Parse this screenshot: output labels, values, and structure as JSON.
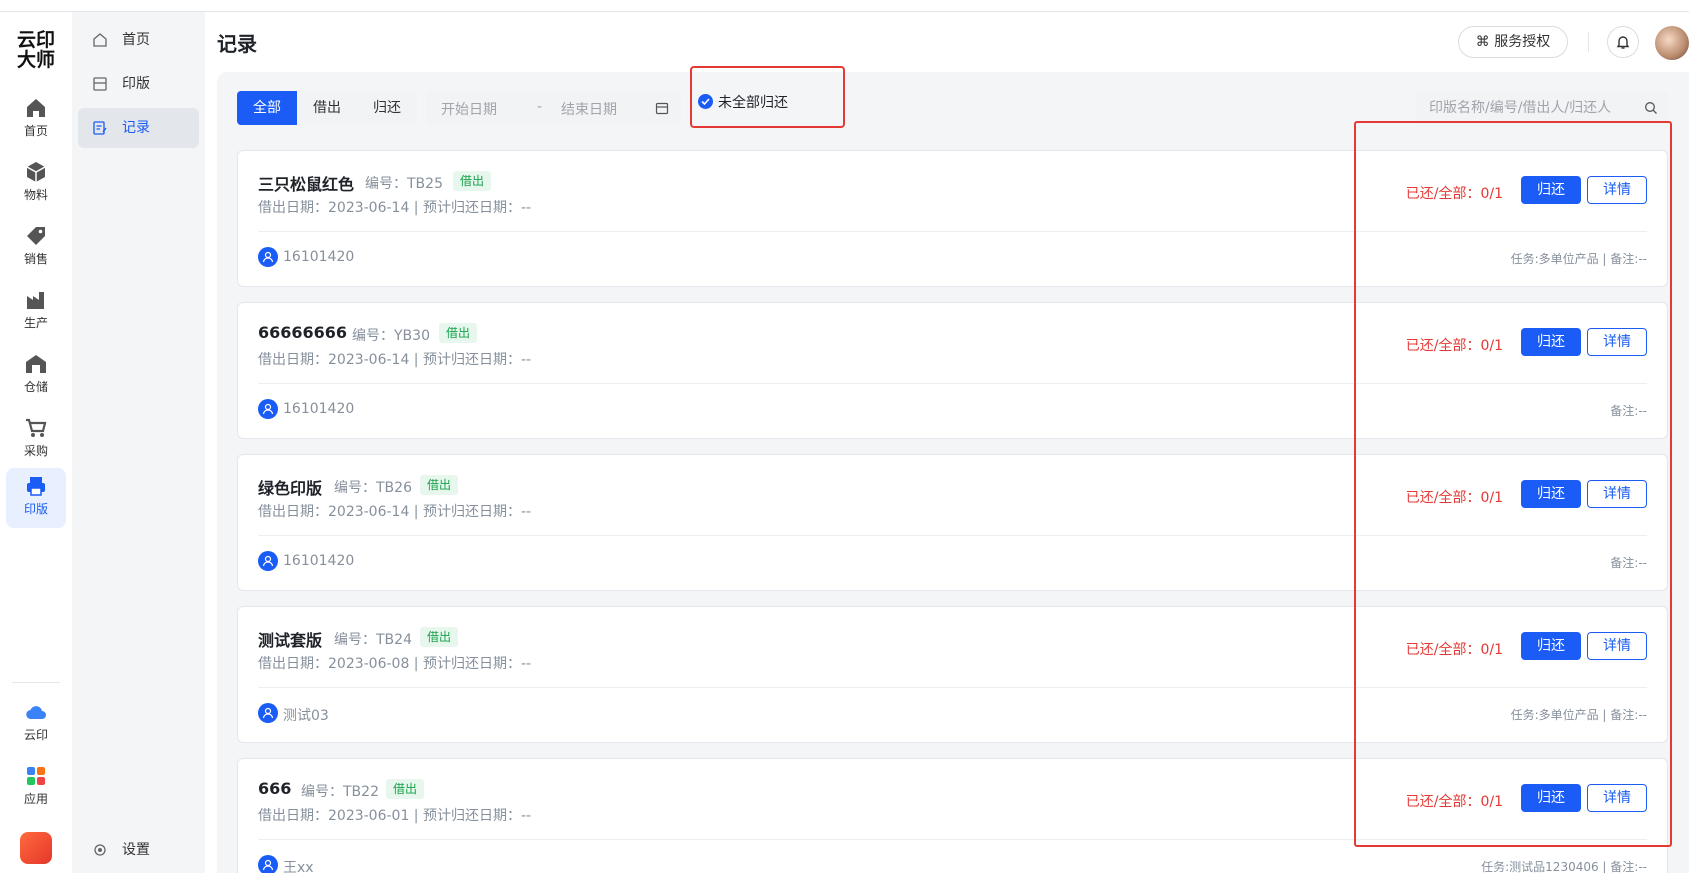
{
  "app": {
    "logo_line1": "云印",
    "logo_line2": "大师"
  },
  "rail": [
    {
      "label": "首页",
      "icon": "home-icon"
    },
    {
      "label": "物料",
      "icon": "cube-icon"
    },
    {
      "label": "销售",
      "icon": "tag-icon"
    },
    {
      "label": "生产",
      "icon": "factory-icon"
    },
    {
      "label": "仓储",
      "icon": "warehouse-icon"
    },
    {
      "label": "采购",
      "icon": "cart-icon"
    },
    {
      "label": "印版",
      "icon": "printer-icon"
    },
    {
      "label": "云印",
      "icon": "cloud-icon"
    },
    {
      "label": "应用",
      "icon": "apps-icon"
    }
  ],
  "sidebar": [
    {
      "label": "首页",
      "icon": "home-outline-icon"
    },
    {
      "label": "印版",
      "icon": "plate-icon"
    },
    {
      "label": "记录",
      "icon": "record-icon"
    },
    {
      "label": "设置",
      "icon": "gear-icon"
    }
  ],
  "header": {
    "title": "记录",
    "service_button": "⌘ 服务授权"
  },
  "filters": {
    "segments": [
      "全部",
      "借出",
      "归还"
    ],
    "start_placeholder": "开始日期",
    "dash": "-",
    "end_placeholder": "结束日期",
    "checkbox_label": "未全部归还",
    "search_placeholder": "印版名称/编号/借出人/归还人"
  },
  "records": [
    {
      "name": "三只松鼠红色",
      "code": "编号：TB25",
      "tag": "借出",
      "meta": "借出日期：2023-06-14 | 预计归还日期：--",
      "user": "16101420",
      "note": "任务:多单位产品 | 备注:--",
      "ratio": "已还/全部：0/1",
      "return_btn": "归还",
      "detail_btn": "详情"
    },
    {
      "name": "66666666",
      "code": "编号：YB30",
      "tag": "借出",
      "meta": "借出日期：2023-06-14 | 预计归还日期：--",
      "user": "16101420",
      "note": "备注:--",
      "ratio": "已还/全部：0/1",
      "return_btn": "归还",
      "detail_btn": "详情"
    },
    {
      "name": "绿色印版",
      "code": "编号：TB26",
      "tag": "借出",
      "meta": "借出日期：2023-06-14 | 预计归还日期：--",
      "user": "16101420",
      "note": "备注:--",
      "ratio": "已还/全部：0/1",
      "return_btn": "归还",
      "detail_btn": "详情"
    },
    {
      "name": "测试套版",
      "code": "编号：TB24",
      "tag": "借出",
      "meta": "借出日期：2023-06-08 | 预计归还日期：--",
      "user": "测试03",
      "note": "任务:多单位产品 | 备注:--",
      "ratio": "已还/全部：0/1",
      "return_btn": "归还",
      "detail_btn": "详情"
    },
    {
      "name": "666",
      "code": "编号：TB22",
      "tag": "借出",
      "meta": "借出日期：2023-06-01 | 预计归还日期：--",
      "user": "王xx",
      "note": "任务:测试品1230406 | 备注:--",
      "ratio": "已还/全部：0/1",
      "return_btn": "归还",
      "detail_btn": "详情"
    }
  ],
  "colors": {
    "accent": "#1a5cf5",
    "danger": "#e53935",
    "success": "#16a34a"
  }
}
